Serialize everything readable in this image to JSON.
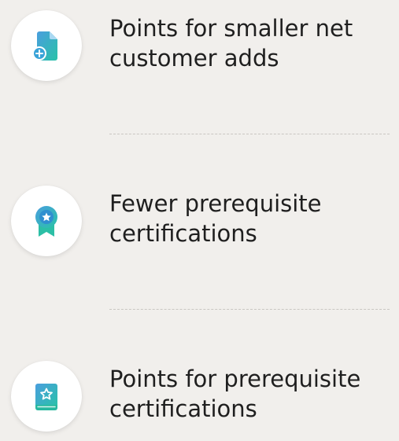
{
  "features": [
    {
      "icon": "document-add-icon",
      "label_line1": "Points for smaller net",
      "label_line2": "customer adds"
    },
    {
      "icon": "award-ribbon-icon",
      "label_line1": "Fewer prerequisite",
      "label_line2": "certifications"
    },
    {
      "icon": "star-book-icon",
      "label_line1": "Points for prerequisite",
      "label_line2": "certifications"
    }
  ],
  "colors": {
    "background": "#f1efec",
    "icon_gradient_start": "#4a9ede",
    "icon_gradient_end": "#29c2a8",
    "text": "#1f1f1f",
    "divider": "#c9c6c2"
  }
}
